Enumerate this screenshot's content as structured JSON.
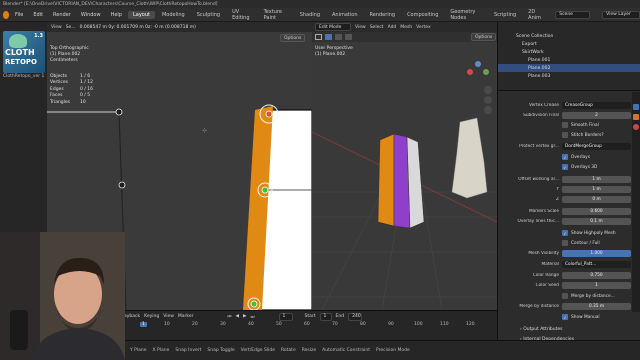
{
  "window": {
    "title": "Blender* [E:\\OneDrive\\VICTORIAN_DEV\\Characters\\Course_Cloth\\WIP\\ClothRetopoHowTo.blend]"
  },
  "menu": {
    "items": [
      "File",
      "Edit",
      "Render",
      "Window",
      "Help"
    ],
    "workspaces": [
      "Layout",
      "Modeling",
      "Sculpting",
      "UV Editing",
      "Texture Paint",
      "Shading",
      "Animation",
      "Rendering",
      "Compositing",
      "Geometry Nodes",
      "Scripting",
      "2D Anim"
    ],
    "active_workspace": "Layout",
    "scene_label": "Scene",
    "view_layer_label": "View Layer"
  },
  "left_panel": {
    "thumb_number": "1.3",
    "thumb_title_1": "CLOTH",
    "thumb_title_2": "RETOPO",
    "image_label": "ClothRetopo_ver 1"
  },
  "viewport_left": {
    "header": [
      "View",
      "Se..."
    ],
    "coords": "0.008547 m   0y: 0.001709 m   0z: -0 m (0.008718 m)",
    "options_label": "Options",
    "view_name": "Top Orthographic",
    "object_name": "(1) Plane.002",
    "units": "Centimeters",
    "stats": [
      {
        "k": "Objects",
        "v": "1 / 6"
      },
      {
        "k": "Vertices",
        "v": "1 / 12"
      },
      {
        "k": "Edges",
        "v": "0 / 16"
      },
      {
        "k": "Faces",
        "v": "0 / 5"
      },
      {
        "k": "Triangles",
        "v": "10"
      }
    ]
  },
  "viewport_right": {
    "mode": "Edit Mode",
    "header": [
      "View",
      "Select",
      "Add",
      "Mesh",
      "Vertex"
    ],
    "options_label": "Options",
    "view_name": "User Perspective",
    "object_name": "(1) Plane.002"
  },
  "outliner": {
    "rows": [
      {
        "label": "Scene Collection",
        "sel": false
      },
      {
        "label": "Export",
        "sel": false
      },
      {
        "label": "SkirtWork",
        "sel": false
      },
      {
        "label": "Plane.001",
        "sel": false
      },
      {
        "label": "Plane.002",
        "sel": true
      },
      {
        "label": "Plane.003",
        "sel": false
      }
    ]
  },
  "properties": {
    "vertex_crease_label": "Vertex Crease",
    "vertex_crease_value": "CreaseGroup",
    "subdiv_final_label": "Subdivision Final",
    "subdiv_final_value": "2",
    "smooth_final": "Smooth Final",
    "stitch_borders": "Stitch Borders?",
    "protect_label": "Protect vertex gr...",
    "protect_value": "DontMergeGroup",
    "overlays": "Overlays",
    "overlays_3d": "Overlays 3D",
    "offset_working_label": "Offset working ar...",
    "offset_x": "1 m",
    "offset_y_label": "Y",
    "offset_y": "1 m",
    "offset_z_label": "Z",
    "offset_z": "0 m",
    "markers_scale_label": "Markers Scale",
    "markers_scale": "0.600",
    "overlay_lines_label": "Overlay lines thic...",
    "overlay_lines": "0.1 m",
    "show_highpoly": "Show Highpoly Mesh",
    "contour_full": "Contour / Full",
    "mesh_visibility_label": "Mesh Visibility",
    "mesh_visibility": "1.000",
    "material_label": "Material",
    "material_value": "Colorful_Patt...",
    "color_range_label": "Color Range",
    "color_range": "0.750",
    "color_seed_label": "Color Seed",
    "color_seed": "1",
    "merge_by_distance": "Merge by distance...",
    "merge_dist_label": "Merge by distance",
    "merge_dist": "0.35 m",
    "show_manual": "Show Manual",
    "output_attributes": "Output Attributes",
    "internal_dependencies": "Internal Dependencies"
  },
  "timeline": {
    "controls": [
      "Playback",
      "Keying",
      "View",
      "Marker"
    ],
    "start_label": "Start",
    "start": "1",
    "end_label": "End",
    "end": "240",
    "current_frame": "1",
    "ticks": [
      "1",
      "10",
      "20",
      "30",
      "40",
      "50",
      "60",
      "70",
      "80",
      "90",
      "100",
      "110",
      "120"
    ]
  },
  "statusbar": {
    "items": [
      "Y Plane",
      "X Plane",
      "Snap Invert",
      "Snap Toggle",
      "Vert/Edge Slide",
      "Rotate",
      "Resize",
      "Automatic Constraint",
      "Precision Mode"
    ]
  }
}
